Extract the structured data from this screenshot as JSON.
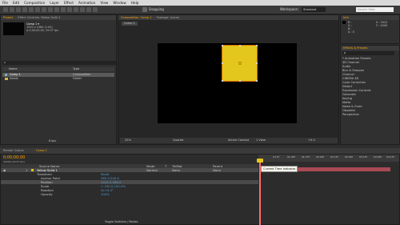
{
  "menubar": [
    "File",
    "Edit",
    "Composition",
    "Layer",
    "Effect",
    "Animation",
    "View",
    "Window",
    "Help"
  ],
  "toolbar": {
    "snapping_label": "Snapping",
    "workspace_label": "Workspace:",
    "workspace_value": "Standard",
    "search_placeholder": "Search Help"
  },
  "project": {
    "tab": "Project",
    "tab_effects": "Effect Controls: Yellow Solid 1",
    "comp_name": "Comp 1 ▾",
    "meta": [
      "1920 x 1080 (1.00)",
      "Δ 0;00;05;00, 29.97 fps"
    ],
    "search_placeholder": "ρ",
    "col_name": "Name",
    "col_type": "Type",
    "items": [
      {
        "name": "Comp 1",
        "type": "Composition"
      },
      {
        "name": "Solids",
        "type": "Folder"
      }
    ],
    "bpc": "8 bpc"
  },
  "viewer": {
    "tab": "Composition: Comp 1",
    "tab2": "Footage: (none)",
    "comp_button": "Comp 1",
    "zoom": "25%",
    "quarter": "Quarter",
    "camera": "Active Camera",
    "view": "1 View",
    "plus": "+0.0"
  },
  "info": {
    "tab": "Info",
    "rgb": [
      "R :",
      "G :",
      "B :",
      "A : 0"
    ],
    "xy": [
      "X : 2312",
      "Y : 1040"
    ]
  },
  "effects": {
    "tab": "Effects & Presets",
    "search_placeholder": "ρ",
    "items": [
      "* Animation Presets",
      "3D Channel",
      "Audio",
      "Blur & Sharpen",
      "Channel",
      "CINEMA 4D",
      "Color Correction",
      "Distort",
      "Expression Controls",
      "Generate",
      "Keying",
      "Matte",
      "Noise & Grain",
      "Obsolete",
      "Perspective"
    ]
  },
  "timeline": {
    "tabs": [
      "Render Queue",
      "Comp 1"
    ],
    "timecode": "0;00;00;00",
    "fps_label": "00000 (29.97 fps)",
    "col_source": "Source Name",
    "col_mode": "Mode",
    "col_t": "T",
    "col_trkmat": "TrkMat",
    "col_parent": "Parent",
    "layer": {
      "num": "1",
      "name": "Yellow Solid 1",
      "mode": "Normal",
      "trkmat": "None",
      "parent": "None"
    },
    "transform_label": "Transform",
    "transform_reset": "Reset",
    "props": [
      {
        "name": "Anchor Point",
        "value": "960.0,540.0"
      },
      {
        "name": "Position",
        "value": "1424.0,286.0"
      },
      {
        "name": "Scale",
        "value": "∞ 100.0,100.0%"
      },
      {
        "name": "Rotation",
        "value": "0x+0.0°"
      },
      {
        "name": "Opacity",
        "value": "100%"
      }
    ],
    "ruler": [
      "0:15f",
      "01:00f",
      "01:15f",
      "02:00f",
      "02:15f",
      "03:00f",
      "03:15f",
      "04:00f",
      "04:15f",
      "05:0"
    ],
    "tooltip": "Current Time Indicator",
    "toggle_label": "Toggle Switches / Modes"
  },
  "colors": {
    "accent": "#ffa500",
    "solid": "#e3c71c",
    "layer_bar": "#a84a54",
    "cti": "#ff6a6a"
  }
}
